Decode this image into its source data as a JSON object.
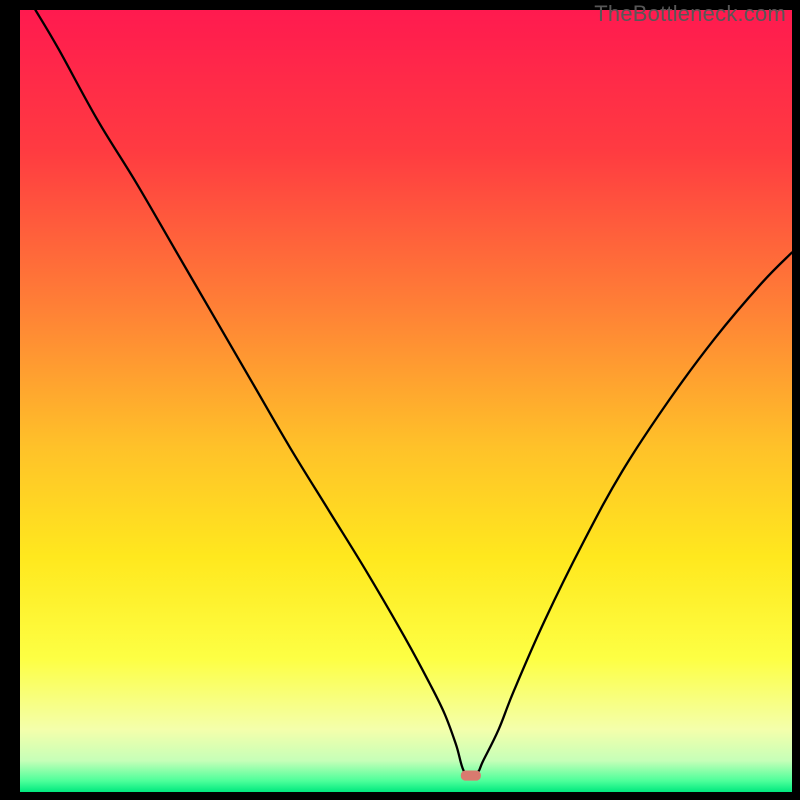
{
  "watermark": "TheBottleneck.com",
  "chart_data": {
    "type": "line",
    "title": "",
    "xlabel": "",
    "ylabel": "",
    "xlim": [
      0,
      100
    ],
    "ylim": [
      0,
      100
    ],
    "background_gradient_stops": [
      {
        "offset": 0,
        "color": "#ff1a4f"
      },
      {
        "offset": 18,
        "color": "#ff3b41"
      },
      {
        "offset": 38,
        "color": "#ff8036"
      },
      {
        "offset": 56,
        "color": "#ffc229"
      },
      {
        "offset": 70,
        "color": "#ffe81e"
      },
      {
        "offset": 83,
        "color": "#fdff44"
      },
      {
        "offset": 92,
        "color": "#f4ffab"
      },
      {
        "offset": 96,
        "color": "#c6ffb8"
      },
      {
        "offset": 98.6,
        "color": "#4cff9a"
      },
      {
        "offset": 100,
        "color": "#00e87e"
      }
    ],
    "series": [
      {
        "name": "bottleneck-curve",
        "x": [
          2,
          5,
          10,
          15,
          20,
          25,
          30,
          35,
          40,
          45,
          50,
          53,
          55,
          56.5,
          57.6,
          59.2,
          60,
          62,
          64,
          68,
          73,
          78,
          84,
          90,
          96,
          100
        ],
        "y": [
          100,
          95,
          86,
          78,
          69.5,
          61,
          52.5,
          44,
          36,
          28,
          19.5,
          14,
          10,
          6,
          2.5,
          2.5,
          4,
          8,
          13,
          22,
          32,
          41,
          50,
          58,
          65,
          69
        ]
      }
    ],
    "marker": {
      "name": "bottleneck-marker",
      "x": 58.4,
      "y": 2.1,
      "width": 2.6,
      "height": 1.3,
      "color": "#d97a6f"
    }
  }
}
